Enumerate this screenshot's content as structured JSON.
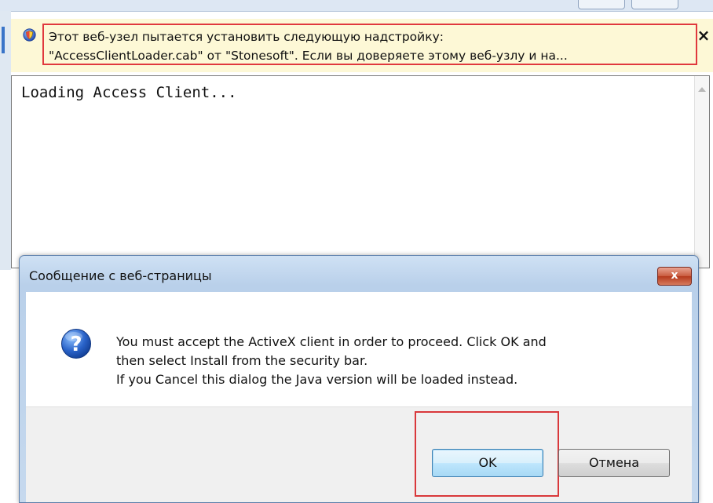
{
  "infobar": {
    "line1": "Этот веб-узел пытается установить следующую надстройку:",
    "line2": "\"AccessClientLoader.cab\" от \"Stonesoft\". Если вы доверяете этому веб-узлу и на...",
    "icon": "shield-icon",
    "close_label": "×"
  },
  "console": {
    "text": "Loading Access Client..."
  },
  "dialog": {
    "title": "Сообщение с веб-страницы",
    "close_label": "x",
    "icon": "question-icon",
    "lines": [
      "You must accept the ActiveX client in order to proceed. Click OK and",
      "then select Install from the security bar.",
      "If you Cancel this dialog the Java version will be loaded instead."
    ],
    "ok_label": "OK",
    "cancel_label": "Отмена"
  },
  "colors": {
    "highlight": "#e0383d",
    "infobar_bg": "#fdf8d6",
    "dialog_frame": "#c6d9ee"
  }
}
